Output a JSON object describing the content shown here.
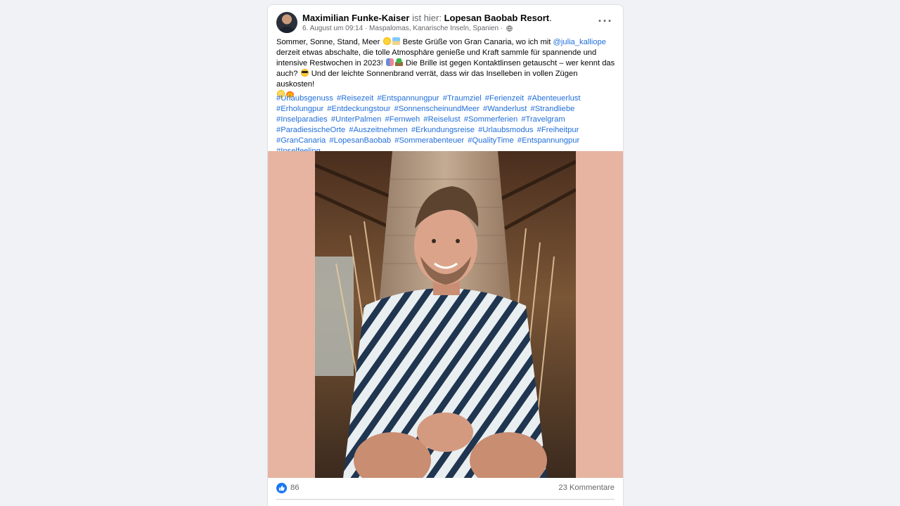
{
  "post": {
    "author": "Maximilian Funke-Kaiser",
    "checkin_text": "ist hier:",
    "place": "Lopesan Baobab Resort",
    "place_suffix": ".",
    "timestamp": "6. August um 09:14",
    "location_meta": "· Maspalomas, Kanarische Inseln, Spanien ·",
    "more_label": "···",
    "text_parts": {
      "p1": "Sommer, Sonne, Stand, Meer",
      "p2": "Beste Grüße von Gran Canaria, wo ich mit",
      "mention": "@julia_kalliope",
      "p3": "derzeit etwas abschalte, die tolle Atmosphäre genieße und Kraft sammle für spannende und intensive Restwochen in 2023!",
      "p4": "Die Brille ist gegen Kontaktlinsen getauscht – wer kennt das auch?",
      "p5": "Und der leichte Sonnenbrand verrät, dass wir das Inselleben in vollen Zügen auskosten!"
    },
    "hashtags": [
      "#Urlaubsgenuss",
      "#Reisezeit",
      "#Entspannungpur",
      "#Traumziel",
      "#Ferienzeit",
      "#Abenteuerlust",
      "#Erholungpur",
      "#Entdeckungstour",
      "#SonnenscheinundMeer",
      "#Wanderlust",
      "#Strandliebe",
      "#Inselparadies",
      "#UnterPalmen",
      "#Fernweh",
      "#Reiselust",
      "#Sommerferien",
      "#Travelgram",
      "#ParadiesischeOrte",
      "#Auszeitnehmen",
      "#Erkundungsreise",
      "#Urlaubsmodus",
      "#Freiheitpur",
      "#GranCanaria",
      "#LopesanBaobab",
      "#Sommerabenteuer",
      "#QualityTime",
      "#Entspannungpur",
      "#Inselfeeling"
    ],
    "photo_background": "#e6b4a1",
    "reactions": {
      "like_count": "86",
      "comment_count": "23 Kommentare"
    }
  },
  "colors": {
    "link": "#216fdb",
    "secondary_text": "#65676b",
    "like_blue": "#1877f2",
    "page_background": "#f0f2f5"
  },
  "icons": [
    "avatar",
    "globe-icon",
    "more-icon",
    "like-icon"
  ]
}
